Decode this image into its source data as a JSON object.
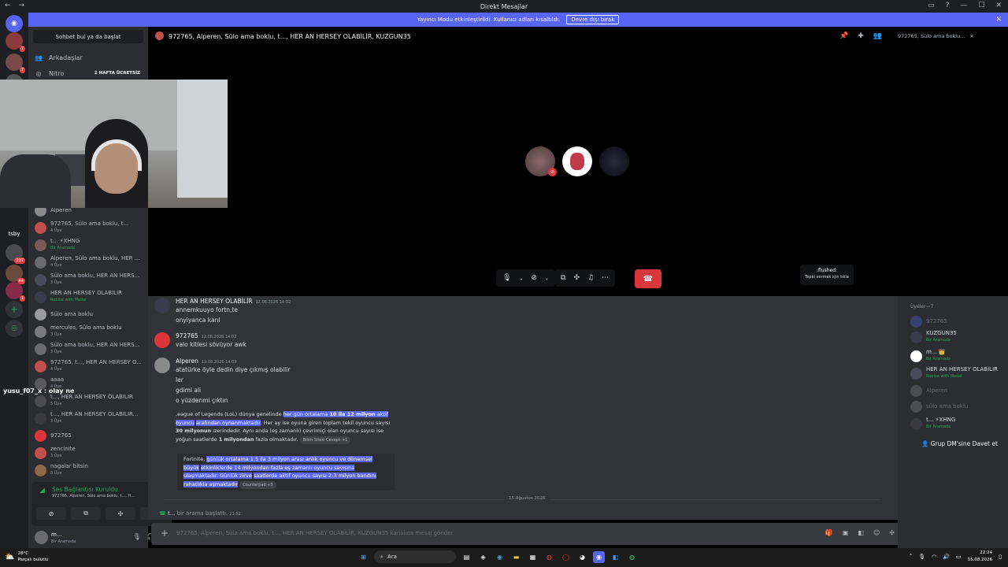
{
  "window": {
    "title": "Direkt Mesajlar"
  },
  "banner": {
    "text": "Yayıncı Modu etkinleştirildi. Kullanıcı adları kısaltıldı.",
    "button": "Devre dışı bırak"
  },
  "sidebar": {
    "search_placeholder": "Sohbet bul ya da başlat",
    "friends": "Arkadaşlar",
    "nitro": "Nitro",
    "nitro_tag": "2 HAFTA ÜCRETSİZ",
    "dms": [
      {
        "name": "Alperen",
        "sub": ""
      },
      {
        "name": "972765, Sülo ama boklu, t...",
        "sub": "4 Üye"
      },
      {
        "name": "t... ⚡XHNG",
        "sub": "Bir Aramada"
      },
      {
        "name": "Alperen, Sülo ama boklu, HER ...",
        "sub": "4 Üye"
      },
      {
        "name": "Sülo ama boklu, HER AN HERS...",
        "sub": "3 Üye"
      },
      {
        "name": "HER AN HERSEY OLABİLİR",
        "sub": "Roblox with Medal"
      },
      {
        "name": "Sülo ama boklu",
        "sub": ""
      },
      {
        "name": "mercules, Sülo ama boklu",
        "sub": "3 Üye"
      },
      {
        "name": "Sülo ama boklu, HER AN HERS...",
        "sub": "3 Üye"
      },
      {
        "name": "972765, t..., HER AN HERSEY O...",
        "sub": "4 Üye"
      },
      {
        "name": "aaaa",
        "sub": "4 Üye"
      },
      {
        "name": "t..., HER AN HERSEY OLABİLİR",
        "sub": "5 Üye"
      },
      {
        "name": "t..., HER AN HERSEY OLABİLİR...",
        "sub": "3 Üye"
      },
      {
        "name": "972765",
        "sub": ""
      },
      {
        "name": "zencinite",
        "sub": "3 Üye"
      },
      {
        "name": "nagalar bitsin",
        "sub": "8 Üye"
      }
    ],
    "server_label": "tsby",
    "voice": {
      "status": "Ses Bağlantısı Kuruldu",
      "channel": "972765, Alperen, Sülo ama boklu, t..., H..."
    },
    "user": {
      "name": "m...",
      "status": "Bir Aramada"
    }
  },
  "header": {
    "title": "972765, Alperen, Sülo ama boklu, t..., HER AN HERSEY OLABİLİR, KUZGUN35",
    "search": "972765, Sülo ama boklu..."
  },
  "call": {
    "tooltip_title": ":flushed:",
    "tooltip_sub": "Tepki vermek için tıkla"
  },
  "overlay_text": "yusu_f07_x : olay ne",
  "messages": [
    {
      "author": "HER AN HERSEY OLABİLİR",
      "time": "12.08.2026 14:02",
      "lines": [
        "annemkuuyo fortn,te",
        "onyiyanca kanl"
      ]
    },
    {
      "author": "972765",
      "time": "12.08.2026 14:02",
      "lines": [
        "valo kitlesi sövüyor awk"
      ]
    },
    {
      "author": "Alperen",
      "time": "12.08.2026 14:09",
      "lines": [
        "atatürke öyle dedin diye çıkmış olabilir",
        "ler",
        "gdimi ali",
        "o yüzdenmi çıktın"
      ]
    }
  ],
  "embed1": {
    "p1": ".eague of Legends (LoL) dünya genelinde ",
    "h1": "her gün ortalama ",
    "b1": "10 ila 12 milyon",
    "h2": " aktif oyuncu",
    "h3": "arafından oynanmaktadır",
    "p2": ". Her ay ise oyuna giren toplam tekil oyuncu sayısı ",
    "b2": "30 milyonun",
    "p3": "ızerindedir. Aynı anda (eş zamanlı) çevrimiçi olan oyuncu sayısı ise yoğun saatlerde ",
    "b3": "1",
    "b4": "milyondan",
    "p4": " fazla olmaktadır.",
    "cite": "Bilim Sitesi Cevaplı +1"
  },
  "embed2": {
    "p1": "Fortnite, ",
    "h1": "günlük ortalama 1.5 ila 3 milyon arası anlık oyuncu ve dönemsel büyük",
    "h2": "etkinliklerde 14 milyondan fazla eş zamanlı oyuncu sayısına ulaşmaktadır. Günlük zirve",
    "h3": "saatlerde aktif oyuncu sayısı 2-3 milyon bandını rahatlıkla aşmaktadır",
    "cite": "Counterpad +3"
  },
  "divider": "15 Ağustos 2026",
  "sysmsg": {
    "user": "t...",
    "text": " bir arama başlattı. ",
    "time": "21:52"
  },
  "input_placeholder": "972765, Alperen, Sülo ama boklu, t..., HER AN HERSEY OLABİLİR, KUZGUN35 kanalına mesaj gönder",
  "members": {
    "header": "Üyeler—7",
    "list": [
      {
        "name": "972765",
        "sub": "",
        "off": true
      },
      {
        "name": "KUZGUN35",
        "sub": "Bir Aramada",
        "off": false
      },
      {
        "name": "m... 👑",
        "sub": "Bir Aramada",
        "off": false
      },
      {
        "name": "HER AN HERSEY OLABİLİR",
        "sub": "Roblox with Medal",
        "off": false
      },
      {
        "name": "Alperen",
        "sub": "",
        "off": true
      },
      {
        "name": "sülo ama boklu",
        "sub": "",
        "off": true
      },
      {
        "name": "t... ⚡XHNG",
        "sub": "Bir Aramada",
        "off": false
      }
    ],
    "invite": "Grup DM'sine Davet et"
  },
  "taskbar": {
    "temp": "28°C",
    "weather": "Parçalı bulutlu",
    "search": "Ara",
    "time": "22:24",
    "date": "15.08.2026"
  }
}
